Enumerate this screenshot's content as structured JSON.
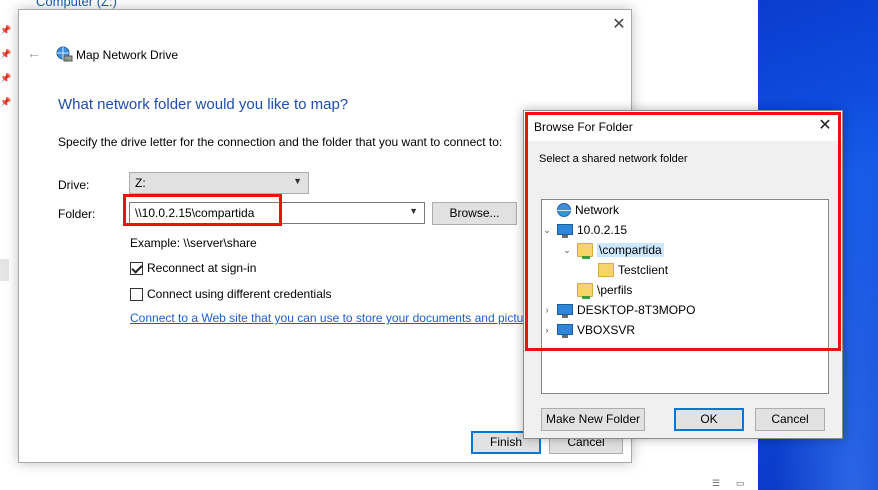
{
  "background": {
    "breadcrumb": "Computer (Z:)",
    "pins": [
      "pin-1",
      "pin-2",
      "pin-3",
      "pin-4"
    ]
  },
  "wizard": {
    "window_title": "Map Network Drive",
    "heading": "What network folder would you like to map?",
    "description": "Specify the drive letter for the connection and the folder that you want to connect to:",
    "drive_label": "Drive:",
    "drive_value": "Z:",
    "folder_label": "Folder:",
    "folder_value": "\\\\10.0.2.15\\compartida",
    "browse_label": "Browse...",
    "example": "Example: \\\\server\\share",
    "reconnect_label": "Reconnect at sign-in",
    "reconnect_checked": true,
    "credentials_label": "Connect using different credentials",
    "credentials_checked": false,
    "web_link": "Connect to a Web site that you can use to store your documents and pictures.",
    "finish_label": "Finish",
    "cancel_label": "Cancel"
  },
  "browse_dialog": {
    "title": "Browse For Folder",
    "instruction": "Select a shared network folder",
    "tree": {
      "network": "Network",
      "host1": "10.0.2.15",
      "share1": "\\compartida",
      "sub1": "Testclient",
      "share2": "\\perfils",
      "host2": "DESKTOP-8T3MOPO",
      "host3": "VBOXSVR"
    },
    "new_folder_label": "Make New Folder",
    "ok_label": "OK",
    "cancel_label": "Cancel"
  },
  "colors": {
    "accent": "#0078d7",
    "highlight": "#ee1010",
    "heading": "#1f4db0",
    "selection": "#cce8ff",
    "desktop": "#1156e6"
  }
}
